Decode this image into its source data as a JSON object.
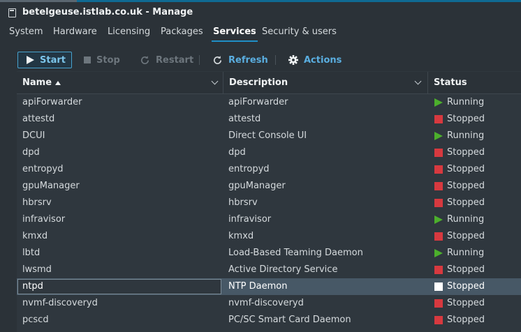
{
  "window": {
    "title": "betelgeuse.istlab.co.uk - Manage"
  },
  "tabs": [
    {
      "label": "System"
    },
    {
      "label": "Hardware"
    },
    {
      "label": "Licensing"
    },
    {
      "label": "Packages"
    },
    {
      "label": "Services",
      "active": true
    },
    {
      "label": "Security & users"
    }
  ],
  "toolbar": {
    "start": "Start",
    "stop": "Stop",
    "restart": "Restart",
    "refresh": "Refresh",
    "actions": "Actions"
  },
  "columns": {
    "name": "Name",
    "description": "Description",
    "status": "Status"
  },
  "services": [
    {
      "name": "apiForwarder",
      "description": "apiForwarder",
      "status": "Running"
    },
    {
      "name": "attestd",
      "description": "attestd",
      "status": "Stopped"
    },
    {
      "name": "DCUI",
      "description": "Direct Console UI",
      "status": "Running"
    },
    {
      "name": "dpd",
      "description": "dpd",
      "status": "Stopped"
    },
    {
      "name": "entropyd",
      "description": "entropyd",
      "status": "Stopped"
    },
    {
      "name": "gpuManager",
      "description": "gpuManager",
      "status": "Stopped"
    },
    {
      "name": "hbrsrv",
      "description": "hbrsrv",
      "status": "Stopped"
    },
    {
      "name": "infravisor",
      "description": "infravisor",
      "status": "Running"
    },
    {
      "name": "kmxd",
      "description": "kmxd",
      "status": "Stopped"
    },
    {
      "name": "lbtd",
      "description": "Load-Based Teaming Daemon",
      "status": "Running"
    },
    {
      "name": "lwsmd",
      "description": "Active Directory Service",
      "status": "Stopped"
    },
    {
      "name": "ntpd",
      "description": "NTP Daemon",
      "status": "Stopped",
      "selected": true
    },
    {
      "name": "nvmf-discoveryd",
      "description": "nvmf-discoveryd",
      "status": "Stopped"
    },
    {
      "name": "pcscd",
      "description": "PC/SC Smart Card Daemon",
      "status": "Stopped"
    }
  ],
  "colors": {
    "accent": "#1f8fc7",
    "running": "#4caf2c",
    "stopped": "#d7393f",
    "selected_row": "#475866"
  }
}
